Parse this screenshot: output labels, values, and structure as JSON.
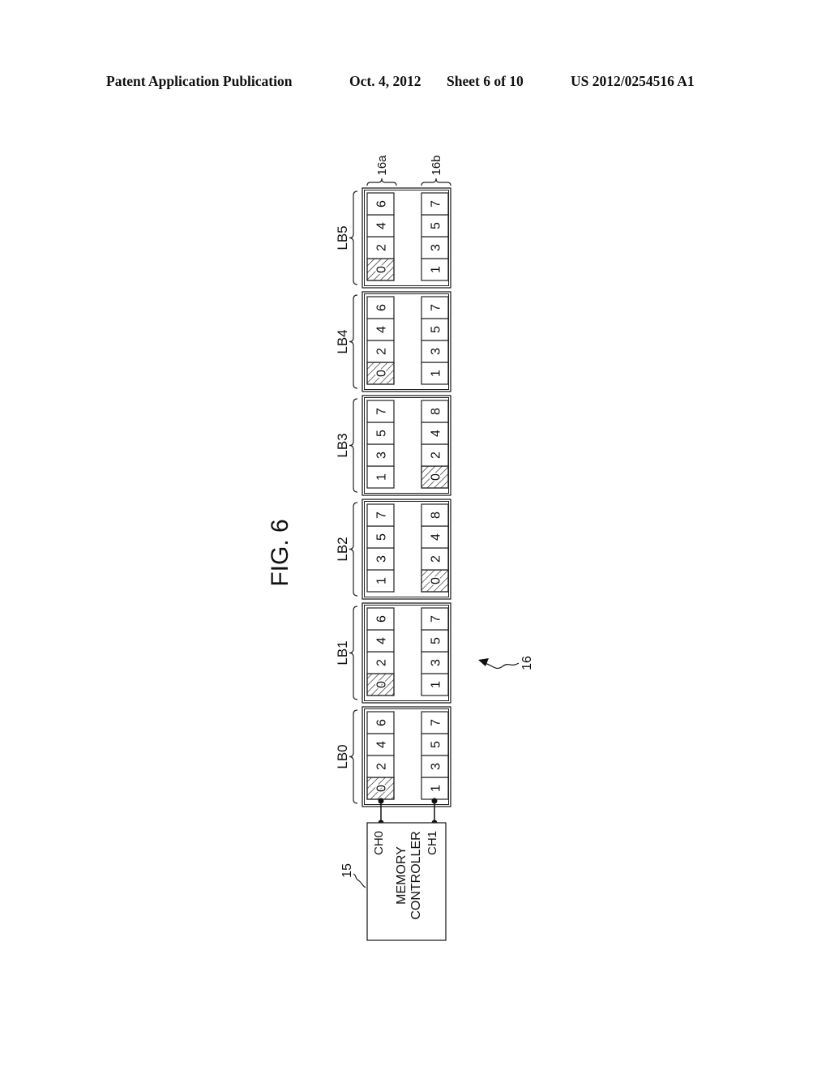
{
  "header": {
    "publication": "Patent Application Publication",
    "date": "Oct. 4, 2012",
    "sheet": "Sheet 6 of 10",
    "number": "US 2012/0254516 A1"
  },
  "figure": {
    "title": "FIG. 6",
    "system_ref": "16",
    "column_refs": [
      "16a",
      "16b"
    ],
    "controller": {
      "ref": "15",
      "label_lines": [
        "MEMORY",
        "CONTROLLER"
      ],
      "channels": [
        "CH0",
        "CH1"
      ]
    },
    "banks": [
      {
        "label": "LB0",
        "col_a": [
          "0",
          "2",
          "4",
          "6"
        ],
        "col_b": [
          "1",
          "3",
          "5",
          "7"
        ],
        "hatched_col": "a"
      },
      {
        "label": "LB1",
        "col_a": [
          "0",
          "2",
          "4",
          "6"
        ],
        "col_b": [
          "1",
          "3",
          "5",
          "7"
        ],
        "hatched_col": "a"
      },
      {
        "label": "LB2",
        "col_a": [
          "1",
          "3",
          "5",
          "7"
        ],
        "col_b": [
          "0",
          "2",
          "4",
          "8"
        ],
        "hatched_col": "b"
      },
      {
        "label": "LB3",
        "col_a": [
          "1",
          "3",
          "5",
          "7"
        ],
        "col_b": [
          "0",
          "2",
          "4",
          "8"
        ],
        "hatched_col": "b"
      },
      {
        "label": "LB4",
        "col_a": [
          "0",
          "2",
          "4",
          "6"
        ],
        "col_b": [
          "1",
          "3",
          "5",
          "7"
        ],
        "hatched_col": "a"
      },
      {
        "label": "LB5",
        "col_a": [
          "0",
          "2",
          "4",
          "6"
        ],
        "col_b": [
          "1",
          "3",
          "5",
          "7"
        ],
        "hatched_col": "a"
      }
    ]
  }
}
